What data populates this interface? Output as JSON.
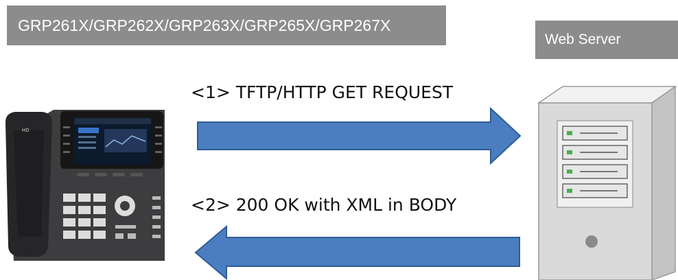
{
  "device": {
    "label": "GRP261X/GRP262X/GRP263X/GRP265X/GRP267X",
    "icon": "ip-phone-icon"
  },
  "server": {
    "label": "Web Server",
    "icon": "server-tower-icon"
  },
  "messages": [
    {
      "label": "<1> TFTP/HTTP GET REQUEST",
      "direction": "device-to-server"
    },
    {
      "label": "<2> 200 OK with XML in BODY",
      "direction": "server-to-device"
    }
  ],
  "colors": {
    "arrow_fill": "#4a7ec0",
    "arrow_stroke": "#2f5c94",
    "label_box": "#8c8c8c"
  }
}
